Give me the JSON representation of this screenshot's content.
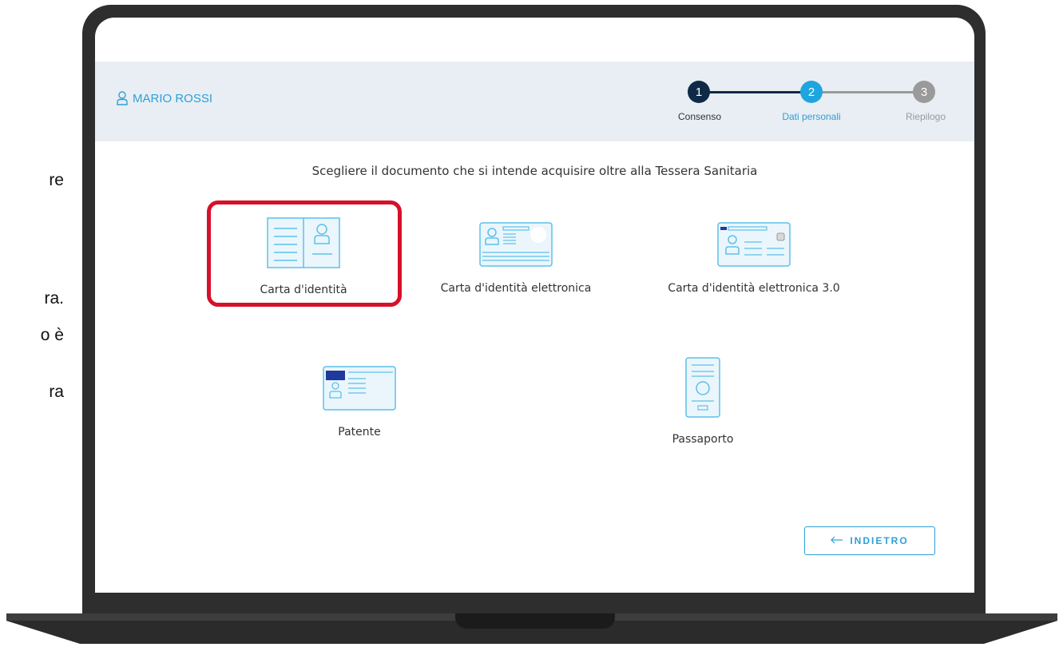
{
  "side_text": [
    "re",
    "ra.",
    "o è",
    "ra"
  ],
  "user": {
    "name": "MARIO ROSSI"
  },
  "stepper": {
    "steps": [
      {
        "number": "1",
        "label": "Consenso"
      },
      {
        "number": "2",
        "label": "Dati personali"
      },
      {
        "number": "3",
        "label": "Riepilogo"
      }
    ],
    "current_step": 2
  },
  "page": {
    "title": "Scegliere il documento che si intende acquisire oltre alla Tessera Sanitaria"
  },
  "documents": [
    {
      "label": "Carta d'identità",
      "icon": "paper-id-card-icon",
      "selected": true
    },
    {
      "label": "Carta d'identità elettronica",
      "icon": "electronic-id-card-icon"
    },
    {
      "label": "Carta d'identità elettronica 3.0",
      "icon": "electronic-id-card-3-icon"
    },
    {
      "label": "Patente",
      "icon": "driving-license-icon"
    },
    {
      "label": "Passaporto",
      "icon": "passport-icon"
    }
  ],
  "actions": {
    "back_label": "INDIETRO"
  },
  "colors": {
    "accent": "#2f9fd8",
    "dark_step": "#0f2a47",
    "inactive": "#9a9a9a",
    "highlight": "#d7102a",
    "header_bg": "#e8eef3"
  }
}
